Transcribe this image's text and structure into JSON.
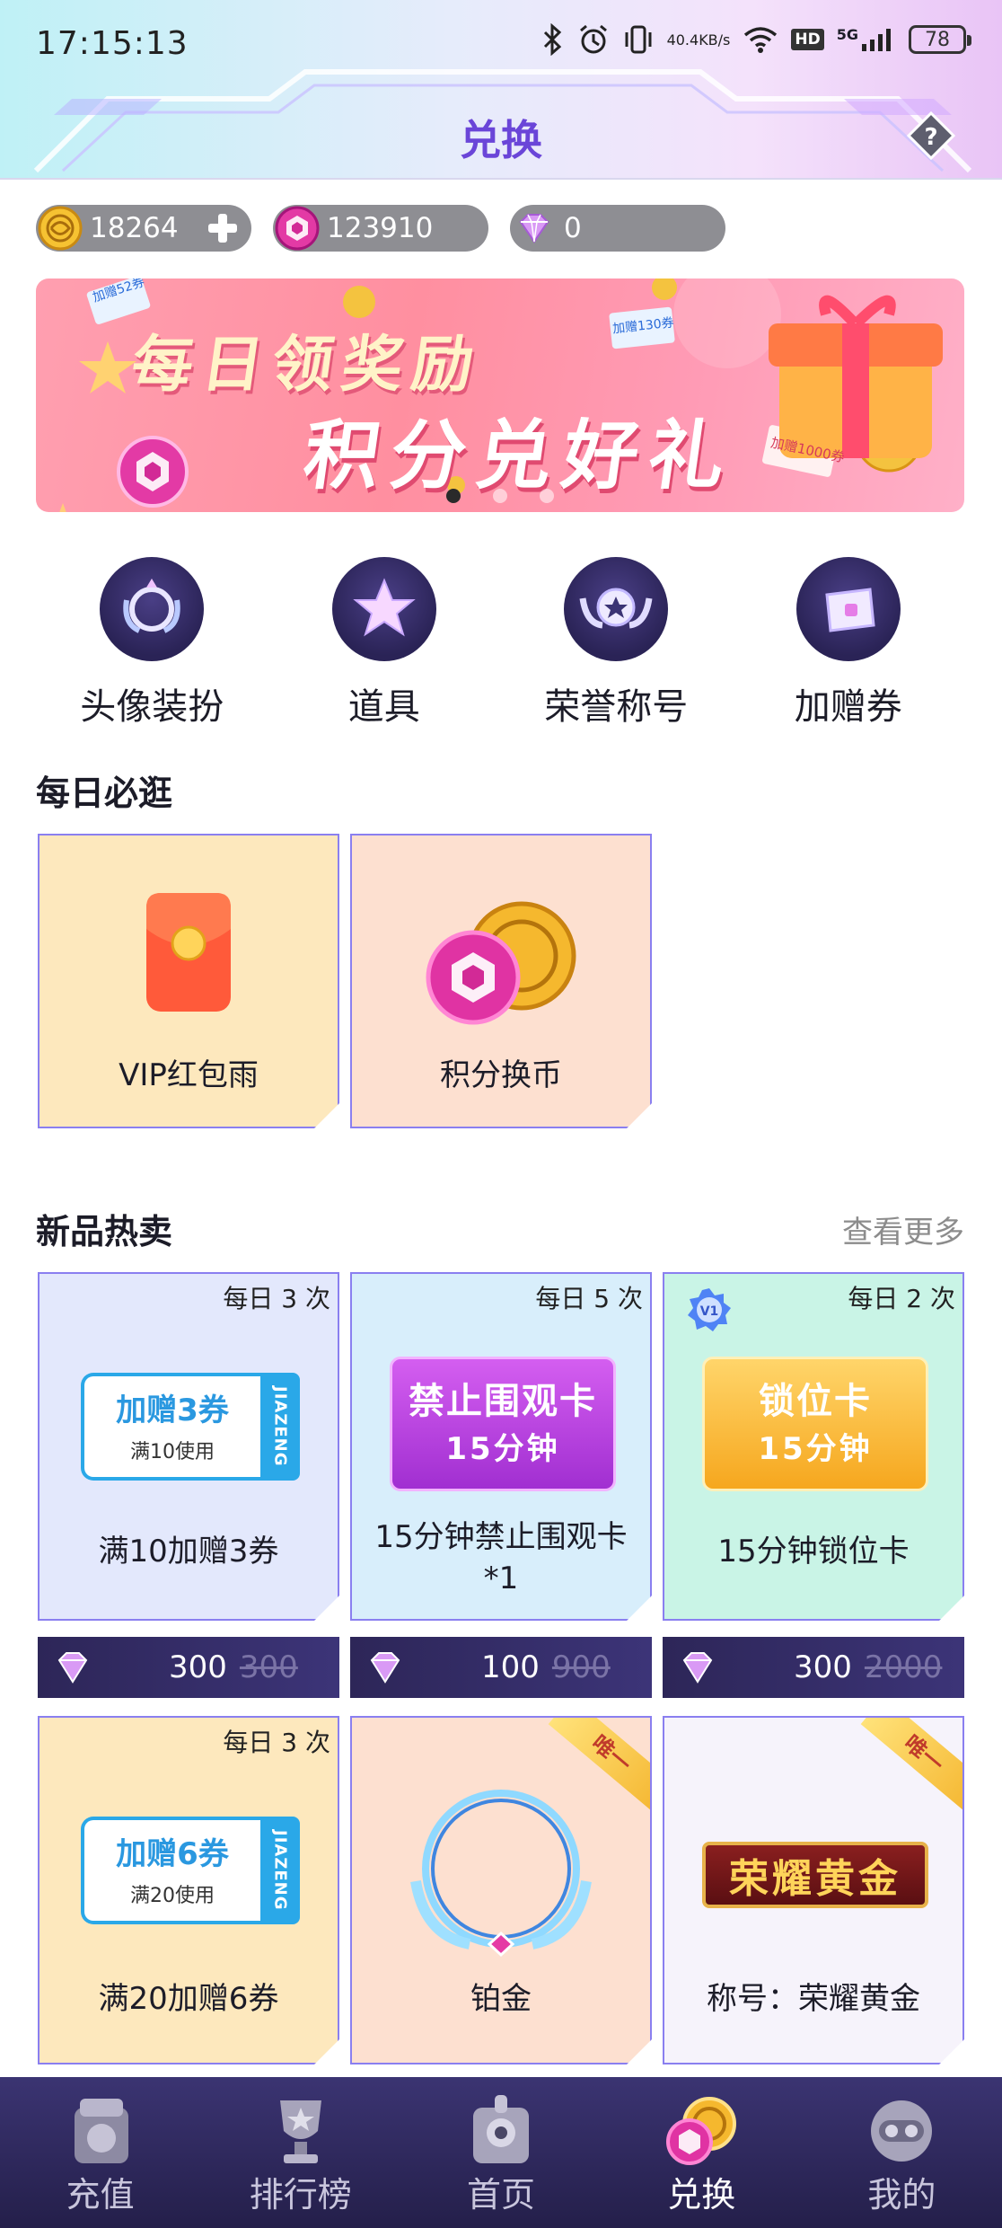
{
  "status_bar": {
    "time": "17:15:13",
    "net_speed_value": "40.4",
    "net_speed_unit": "KB/s",
    "hd": "HD",
    "network": "5G",
    "battery": "78"
  },
  "header": {
    "title": "兑换"
  },
  "balances": [
    {
      "value": "18264",
      "icon": "gold-coin-icon"
    },
    {
      "value": "123910",
      "icon": "pink-points-icon"
    },
    {
      "value": "0",
      "icon": "diamond-icon"
    }
  ],
  "banner": {
    "line1": "每日领奖励",
    "line2": "积分兑好礼",
    "ticket_1": "加赠52券",
    "ticket_2": "加赠130券",
    "ticket_3": "加赠1000券",
    "active_slide": 1,
    "slide_count": 3
  },
  "categories": [
    {
      "label": "头像装扮",
      "icon": "avatar-frame-icon"
    },
    {
      "label": "道具",
      "icon": "star-icon"
    },
    {
      "label": "荣誉称号",
      "icon": "honor-badge-icon"
    },
    {
      "label": "加赠券",
      "icon": "ticket-icon"
    }
  ],
  "daily": {
    "title": "每日必逛",
    "items": [
      {
        "name": "VIP红包雨",
        "icon": "red-envelope-icon"
      },
      {
        "name": "积分换币",
        "icon": "coins-icon"
      }
    ]
  },
  "new_hot": {
    "title": "新品热卖",
    "more": "查看更多",
    "row1": [
      {
        "limit": "每日 3 次",
        "name": "满10加赠3券",
        "coupon_big": "加赠3券",
        "coupon_small": "满10使用",
        "coupon_stub": "JIAZENG",
        "price": "300",
        "old_price": "300"
      },
      {
        "limit": "每日 5 次",
        "name": "15分钟禁止围观卡*1",
        "card_line1": "禁止围观卡",
        "card_line2": "15分钟",
        "price": "100",
        "old_price": "900"
      },
      {
        "limit": "每日 2 次",
        "badge": "V1",
        "name": "15分钟锁位卡",
        "card_line1": "锁位卡",
        "card_line2": "15分钟",
        "price": "300",
        "old_price": "2000"
      }
    ],
    "row2": [
      {
        "limit": "每日 3 次",
        "name": "满20加赠6券",
        "coupon_big": "加赠6券",
        "coupon_small": "满20使用",
        "coupon_stub": "JIAZENG"
      },
      {
        "ribbon": "唯一",
        "name": "铂金"
      },
      {
        "ribbon": "唯一",
        "name": "称号：荣耀黄金",
        "title_art": "荣耀黄金"
      }
    ]
  },
  "bottom_nav": [
    {
      "label": "充值",
      "icon": "recharge-icon",
      "active": false
    },
    {
      "label": "排行榜",
      "icon": "trophy-icon",
      "active": false
    },
    {
      "label": "首页",
      "icon": "home-icon",
      "active": false
    },
    {
      "label": "兑换",
      "icon": "exchange-coin-icon",
      "active": true
    },
    {
      "label": "我的",
      "icon": "profile-icon",
      "active": false
    }
  ],
  "colors": {
    "accent": "#6a45d8",
    "card_border": "#8a7ff0",
    "price_bar": "#2d2658",
    "nav_bg": "#241f4a"
  }
}
